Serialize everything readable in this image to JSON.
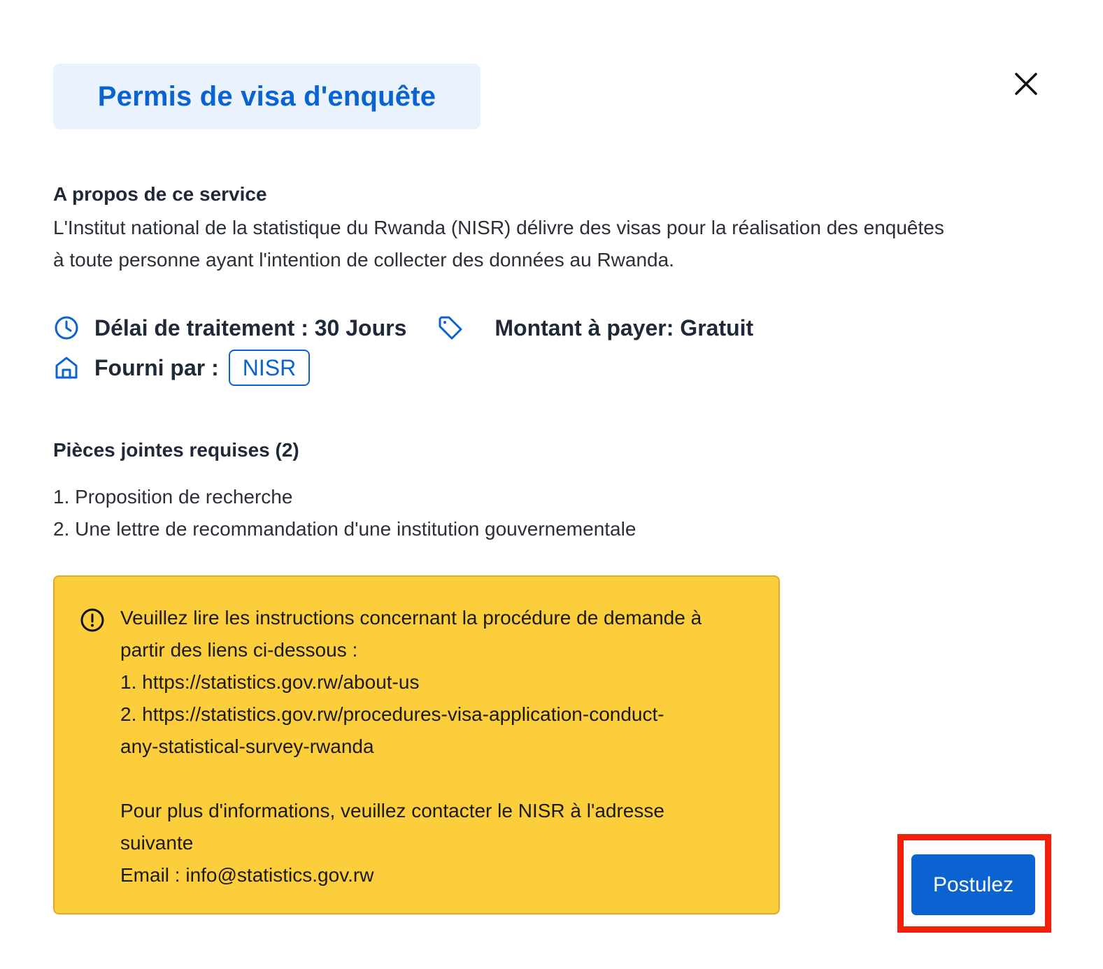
{
  "modal": {
    "title": "Permis de visa d'enquête",
    "close_icon": "close-icon"
  },
  "about": {
    "heading": "A propos de ce service",
    "line1": "L'Institut national de la statistique du Rwanda (NISR) délivre des visas pour la réalisation des enquêtes",
    "line2": "à toute personne ayant l'intention de collecter des données au Rwanda."
  },
  "meta": {
    "processing_time": "Délai de traitement : 30 Jours",
    "amount": "Montant à payer: Gratuit",
    "provided_by_label": "Fourni par :",
    "provider": "NISR",
    "icons": [
      "clock-icon",
      "tag-icon",
      "home-icon"
    ]
  },
  "attachments": {
    "heading": "Pièces jointes requises (2)",
    "items": [
      "1. Proposition de recherche",
      "2. Une lettre de recommandation d'une institution gouvernementale"
    ]
  },
  "notice": {
    "icon": "alert-circle-icon",
    "lines": [
      "Veuillez lire les instructions concernant la procédure de demande à",
      "partir des liens ci-dessous :",
      "1. https://statistics.gov.rw/about-us",
      "2. https://statistics.gov.rw/procedures-visa-application-conduct-",
      "any-statistical-survey-rwanda",
      "Pour plus d'informations, veuillez contacter le NISR à l'adresse",
      "suivante",
      "Email : info@statistics.gov.rw"
    ]
  },
  "actions": {
    "apply_label": "Postulez"
  },
  "colors": {
    "primary": "#0a63d1",
    "title_bg": "#eaf2fd",
    "notice_bg": "#fdce3b",
    "highlight": "#f41f0b"
  }
}
